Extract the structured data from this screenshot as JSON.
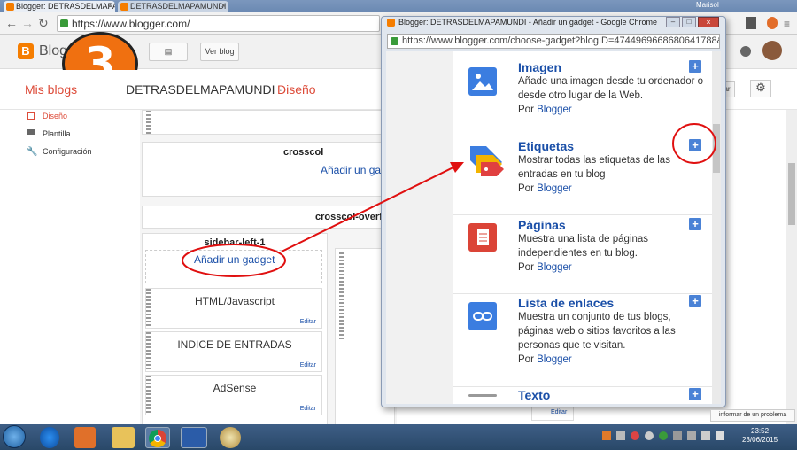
{
  "browser": {
    "tabs": [
      "Blogger: DETRASDELMAPA",
      "DETRASDELMAPAMUNDI"
    ],
    "url": "https://www.blogger.com/",
    "user": "Marisol"
  },
  "blogger_header": {
    "logo_text": "Blog",
    "view_blog_button": "Ver blog",
    "step_number": "3"
  },
  "subbar": {
    "my_blogs": "Mis blogs",
    "blog_name": "DETRASDELMAPAMUNDI",
    "separator": "·",
    "section": "Diseño"
  },
  "sidebar": {
    "items": [
      {
        "label": "Diseño",
        "icon": "layout-icon"
      },
      {
        "label": "Plantilla",
        "icon": "paint-roller-icon"
      },
      {
        "label": "Configuración",
        "icon": "wrench-icon"
      }
    ]
  },
  "layout": {
    "crosscol_title": "crosscol",
    "crosscol_add": "Añadir un gadg",
    "crosscol_overflow_title": "crosscol-overf",
    "sidebar_left_title": "sidebar-left-1",
    "add_gadget": "Añadir un gadget",
    "gadgets": [
      {
        "title": "HTML/Javascript",
        "edit": "Editar"
      },
      {
        "title": "INDICE DE ENTRADAS",
        "edit": "Editar"
      },
      {
        "title": "AdSense",
        "edit": "Editar"
      }
    ],
    "bottom_edit": "Editar"
  },
  "popup": {
    "title": "Blogger: DETRASDELMAPAMUNDI - Añadir un gadget - Google Chrome",
    "url": "https://www.blogger.com/choose-gadget?blogID=4744969668680641788&",
    "gadgets": [
      {
        "name": "Imagen",
        "desc": "Añade una imagen desde tu ordenador o desde otro lugar de la Web.",
        "by": "Por",
        "author": "Blogger",
        "icon": "image-icon",
        "color": "#3b7de0"
      },
      {
        "name": "Etiquetas",
        "desc": "Mostrar todas las etiquetas de las entradas en tu blog",
        "by": "Por",
        "author": "Blogger",
        "icon": "label-tag-icon",
        "color": "#e04040"
      },
      {
        "name": "Páginas",
        "desc": "Muestra una lista de páginas independientes en tu blog.",
        "by": "Por",
        "author": "Blogger",
        "icon": "pages-icon",
        "color": "#db4437"
      },
      {
        "name": "Lista de enlaces",
        "desc": "Muestra un conjunto de tus blogs, páginas web o sitios favoritos a las personas que te visitan.",
        "by": "Por",
        "author": "Blogger",
        "icon": "link-icon",
        "color": "#3b7de0"
      },
      {
        "name": "Texto",
        "desc": "",
        "by": "",
        "author": "",
        "icon": "text-icon",
        "color": "#999999"
      }
    ]
  },
  "report_problem": "informar de un problema",
  "taskbar": {
    "time": "23:52",
    "date": "23/06/2015"
  },
  "accent_colors": {
    "blogger_orange": "#f57d00",
    "link_blue": "#1a4fa8",
    "annotation_red": "#e01010"
  }
}
